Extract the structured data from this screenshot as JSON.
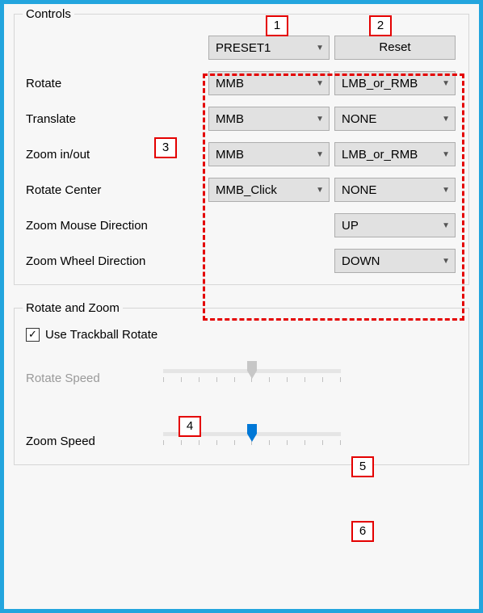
{
  "controls": {
    "legend": "Controls",
    "preset_value": "PRESET1",
    "reset_label": "Reset",
    "rows": {
      "rotate": {
        "label": "Rotate",
        "c1": "MMB",
        "c2": "LMB_or_RMB"
      },
      "translate": {
        "label": "Translate",
        "c1": "MMB",
        "c2": "NONE"
      },
      "zoom": {
        "label": "Zoom in/out",
        "c1": "MMB",
        "c2": "LMB_or_RMB"
      },
      "rotate_center": {
        "label": "Rotate Center",
        "c1": "MMB_Click",
        "c2": "NONE"
      },
      "zoom_mouse": {
        "label": "Zoom Mouse Direction",
        "c2": "UP"
      },
      "zoom_wheel": {
        "label": "Zoom Wheel Direction",
        "c2": "DOWN"
      }
    }
  },
  "rotzoom": {
    "legend": "Rotate and Zoom",
    "trackball_label": "Use Trackball Rotate",
    "trackball_checked": true,
    "rotate_speed_label": "Rotate Speed",
    "rotate_speed_enabled": false,
    "rotate_speed_value": 0.5,
    "zoom_speed_label": "Zoom Speed",
    "zoom_speed_enabled": true,
    "zoom_speed_value": 0.5
  },
  "callouts": {
    "1": "1",
    "2": "2",
    "3": "3",
    "4": "4",
    "5": "5",
    "6": "6"
  }
}
